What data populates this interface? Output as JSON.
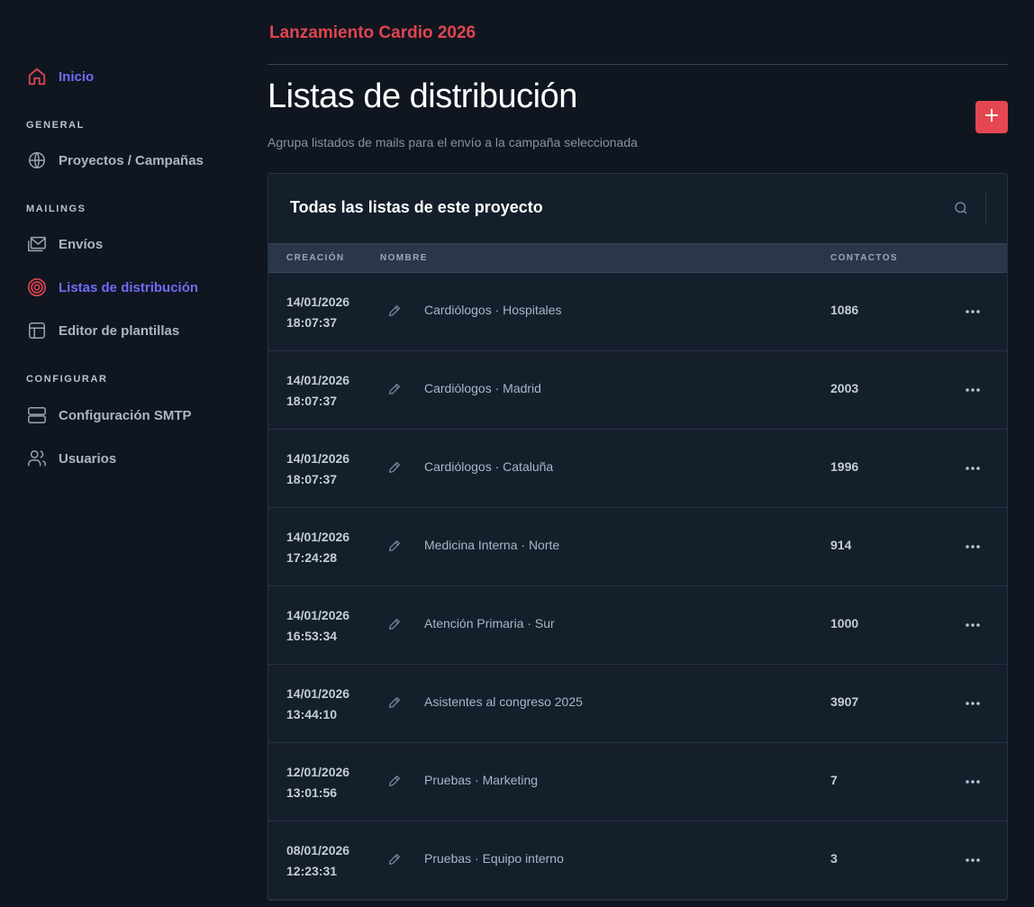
{
  "sidebar": {
    "home": {
      "label": "Inicio",
      "icon": "home-icon"
    },
    "sections": [
      {
        "title": "GENERAL",
        "items": [
          {
            "label": "Proyectos / Campañas",
            "icon": "globe-icon"
          }
        ]
      },
      {
        "title": "MAILINGS",
        "items": [
          {
            "label": "Envíos",
            "icon": "mail-icon"
          },
          {
            "label": "Listas de distribución",
            "icon": "target-icon"
          },
          {
            "label": "Editor de plantillas",
            "icon": "layout-icon"
          }
        ]
      },
      {
        "title": "CONFIGURAR",
        "items": [
          {
            "label": "Configuración SMTP",
            "icon": "server-icon"
          },
          {
            "label": "Usuarios",
            "icon": "users-icon"
          }
        ]
      }
    ]
  },
  "header": {
    "project": "Lanzamiento Cardio 2026",
    "title": "Listas de distribución",
    "subtitle": "Agrupa listados de mails para el envío a la campaña seleccionada",
    "add_icon": "plus-icon"
  },
  "card": {
    "title": "Todas las listas de este proyecto",
    "columns": {
      "created": "CREACIÓN",
      "name": "NOMBRE",
      "contacts": "CONTACTOS"
    },
    "rows": [
      {
        "date": "14/01/2026",
        "time": "18:07:37",
        "name": "Cardiólogos · Hospitales",
        "contacts": "1086"
      },
      {
        "date": "14/01/2026",
        "time": "18:07:37",
        "name": "Cardiólogos · Madrid",
        "contacts": "2003"
      },
      {
        "date": "14/01/2026",
        "time": "18:07:37",
        "name": "Cardiólogos · Cataluña",
        "contacts": "1996"
      },
      {
        "date": "14/01/2026",
        "time": "17:24:28",
        "name": "Medicina Interna · Norte",
        "contacts": "914"
      },
      {
        "date": "14/01/2026",
        "time": "16:53:34",
        "name": "Atención Primaria · Sur",
        "contacts": "1000"
      },
      {
        "date": "14/01/2026",
        "time": "13:44:10",
        "name": "Asistentes al congreso 2025",
        "contacts": "3907"
      },
      {
        "date": "12/01/2026",
        "time": "13:01:56",
        "name": "Pruebas · Marketing",
        "contacts": "7"
      },
      {
        "date": "08/01/2026",
        "time": "12:23:31",
        "name": "Pruebas · Equipo interno",
        "contacts": "3"
      }
    ]
  },
  "colors": {
    "accent": "#e0454f",
    "active": "#6f6cf5",
    "background": "#0f1620"
  }
}
